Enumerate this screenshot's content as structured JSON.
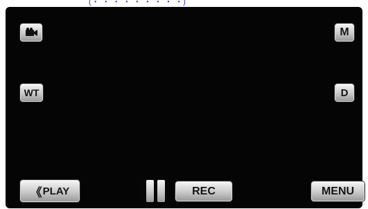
{
  "caption": "(・ ・ ・ ・ ・ ・ ・ ・ ・)",
  "buttons": {
    "mode_icon": "video-camera-icon",
    "manual": "M",
    "wt": "WT",
    "display": "D",
    "play_arrow": "《",
    "play": "PLAY",
    "pause_icon": "pause-icon",
    "rec": "REC",
    "menu": "MENU"
  },
  "colors": {
    "screen_bg": "#050505",
    "button_face": "#c9c9c9",
    "caption_text": "#2a35c8"
  }
}
